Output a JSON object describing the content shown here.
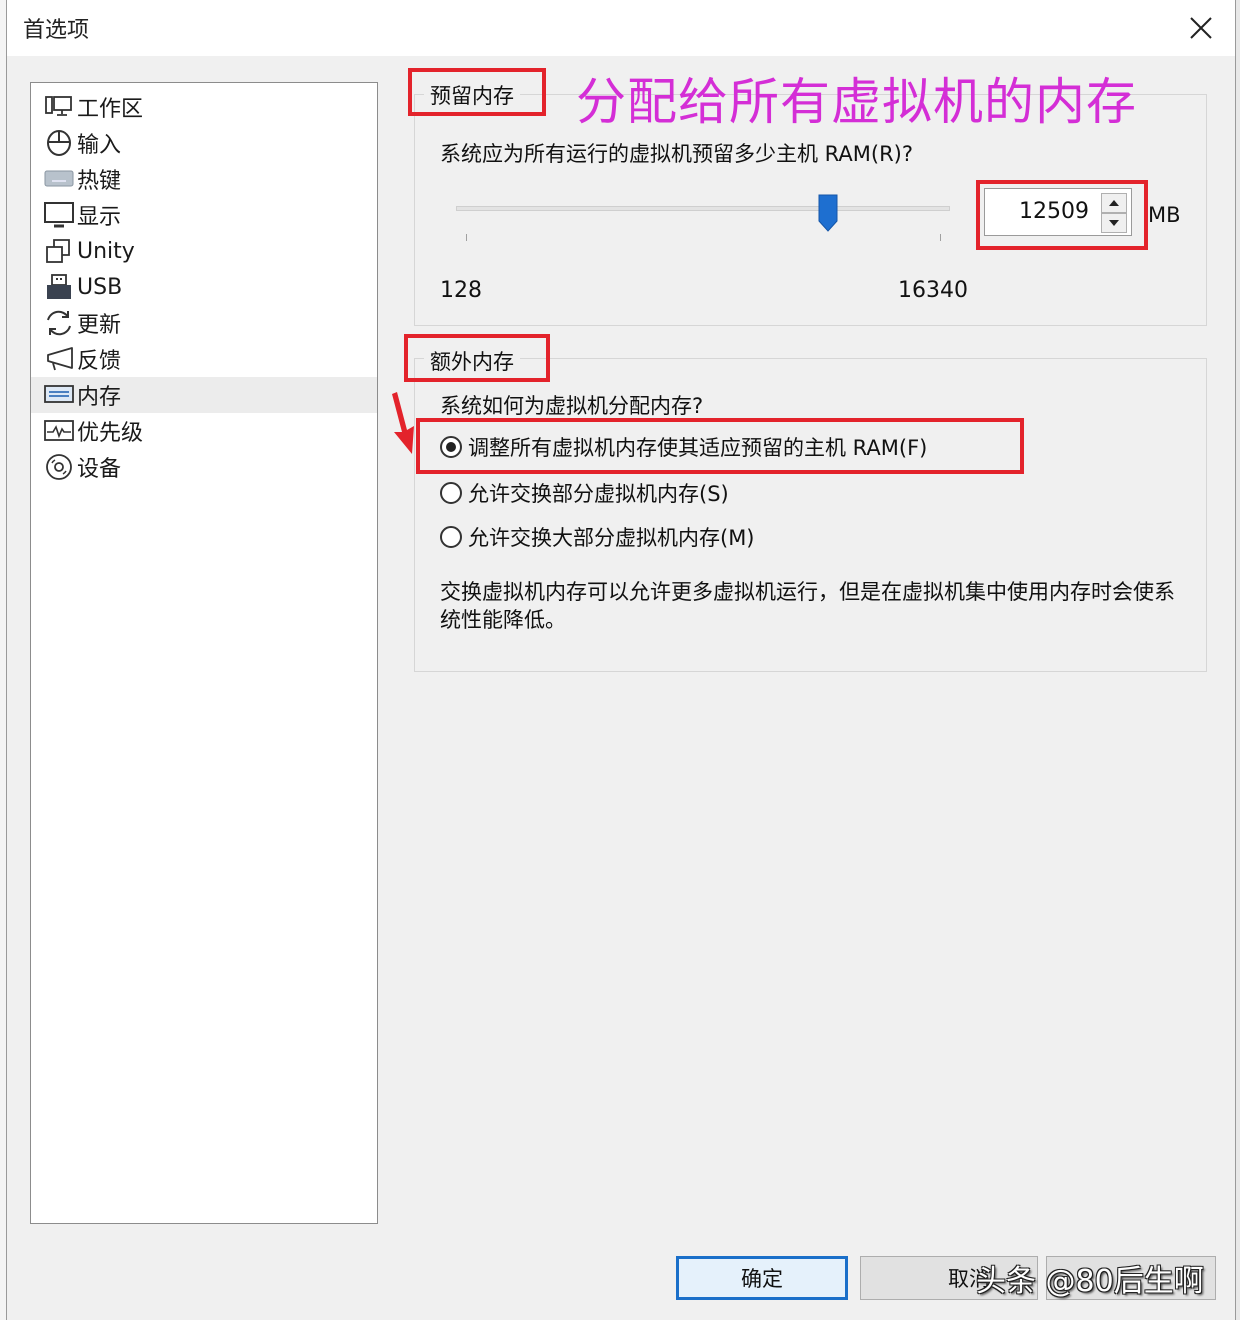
{
  "window": {
    "title": "首选项",
    "close_icon": "close-icon"
  },
  "sidebar": {
    "selected": "内存",
    "items": [
      {
        "label": "工作区",
        "icon": "workspace-icon"
      },
      {
        "label": "输入",
        "icon": "mouse-icon"
      },
      {
        "label": "热键",
        "icon": "keyboard-icon"
      },
      {
        "label": "显示",
        "icon": "monitor-icon"
      },
      {
        "label": "Unity",
        "icon": "unity-windows-icon"
      },
      {
        "label": "USB",
        "icon": "usb-icon"
      },
      {
        "label": "更新",
        "icon": "refresh-icon"
      },
      {
        "label": "反馈",
        "icon": "megaphone-icon"
      },
      {
        "label": "内存",
        "icon": "memory-icon"
      },
      {
        "label": "优先级",
        "icon": "priority-chart-icon"
      },
      {
        "label": "设备",
        "icon": "disc-icon"
      }
    ]
  },
  "reserved_memory": {
    "group_title": "预留内存",
    "question": "系统应为所有运行的虚拟机预留多少主机 RAM(R)?",
    "slider": {
      "min": 128,
      "max": 16340,
      "value": 12509
    },
    "min_label": "128",
    "max_label": "16340",
    "value": "12509",
    "unit": "MB"
  },
  "annotation": {
    "text": "分配给所有虚拟机的内存",
    "color": "#d42ed6",
    "box_color": "#e3232b"
  },
  "additional_memory": {
    "group_title": "额外内存",
    "question": "系统如何为虚拟机分配内存?",
    "options": [
      {
        "label": "调整所有虚拟机内存使其适应预留的主机 RAM(F)",
        "checked": true
      },
      {
        "label": "允许交换部分虚拟机内存(S)",
        "checked": false
      },
      {
        "label": "允许交换大部分虚拟机内存(M)",
        "checked": false
      }
    ],
    "description": "交换虚拟机内存可以允许更多虚拟机运行，但是在虚拟机集中使用内存时会使系统性能降低。"
  },
  "buttons": {
    "ok": "确定",
    "cancel": "取消",
    "help": ""
  },
  "watermark": "头条 @80后生啊",
  "colors": {
    "accent": "#1a6fc9",
    "slider_thumb": "#1e6fd0"
  }
}
